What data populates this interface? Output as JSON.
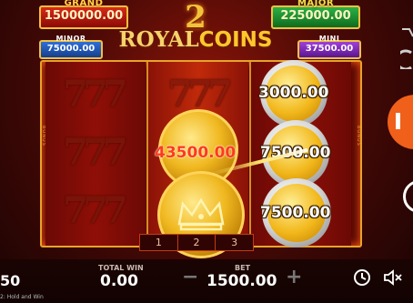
{
  "jackpots": {
    "grand": {
      "title": "GRAND",
      "value": "1500000.00"
    },
    "major": {
      "title": "MAJOR",
      "value": "225000.00"
    },
    "minor": {
      "title": "MINOR",
      "value": "75000.00"
    },
    "mini": {
      "title": "MINI",
      "value": "37500.00"
    }
  },
  "logo": {
    "number": "2",
    "royal": "ROYAL",
    "coins": "COINS"
  },
  "reels": {
    "side_label": "BONUS",
    "seven_symbol": "777",
    "coin_values": {
      "reel3_top": "3000.00",
      "reel3_mid": "7500.00",
      "reel3_bottom": "7500.00",
      "reel2_mid": "43500.00"
    }
  },
  "lines": [
    "1",
    "2",
    "3"
  ],
  "bottom": {
    "balance_partial": "50",
    "total_win_label": "TOTAL WIN",
    "total_win_value": "0.00",
    "bet_label": "BET",
    "bet_value": "1500.00",
    "minus": "−",
    "plus": "+",
    "version_text": "2: Hold and Win"
  },
  "colors": {
    "accent": "#f0601a",
    "gold": "#f0b820",
    "frame": "#e8a32a"
  }
}
